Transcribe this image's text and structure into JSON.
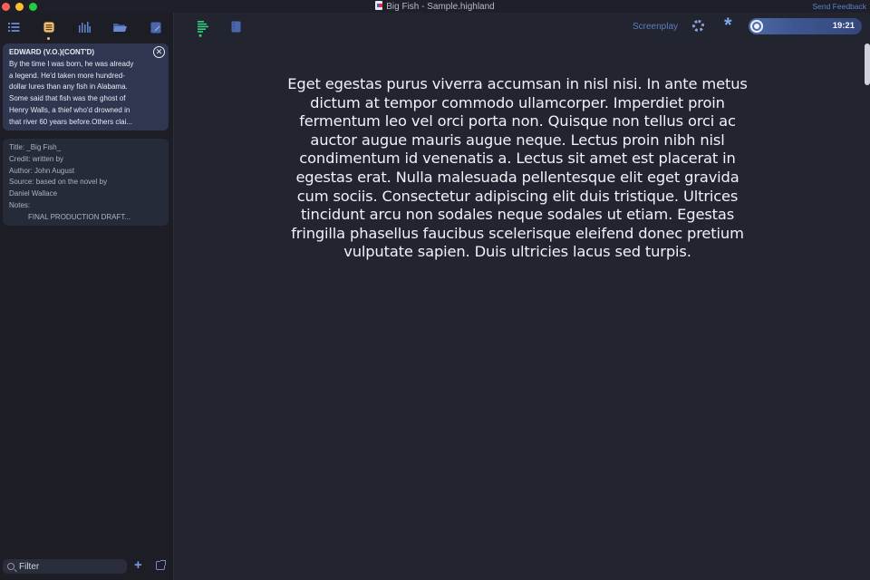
{
  "window": {
    "title": "Big Fish - Sample.highland",
    "send_feedback": "Send Feedback"
  },
  "sidebar": {
    "tabs": [
      {
        "icon": "list-icon",
        "label": "Outline",
        "active": false
      },
      {
        "icon": "scene-cards-icon",
        "label": "Navigator",
        "active": true
      },
      {
        "icon": "stats-icon",
        "label": "Statistics",
        "active": false
      },
      {
        "icon": "folder-icon",
        "label": "Files",
        "active": false
      },
      {
        "icon": "notebook-icon",
        "label": "Notes",
        "active": false
      }
    ],
    "cards": [
      {
        "heading": "EDWARD (V.O.)(CONT'D)",
        "lines": [
          "By the time I was born, he was already",
          "a legend. He'd taken more hundred-",
          "dollar lures than any fish in Alabama.",
          "Some said that fish was the ghost of",
          "Henry Walls, a thief who'd drowned in",
          "that river 60 years before.Others clai..."
        ],
        "close_icon": "close-circle-icon"
      },
      {
        "lines": [
          "Title: _Big Fish_",
          "Credit: written by",
          "Author: John August",
          "Source: based on the novel by",
          "Daniel Wallace",
          "Notes:"
        ],
        "centered_line": "FINAL PRODUCTION DRAFT..."
      }
    ],
    "filter": {
      "placeholder": "Filter",
      "value": ""
    },
    "add_icon": "plus-icon",
    "export_icon": "export-icon"
  },
  "toolbar": {
    "left_icons": [
      "text-align-icon",
      "notebook-icon"
    ],
    "mode_label": "Screenplay",
    "ring_icon": "progress-ring-icon",
    "asterisk_icon": "asterisk-icon",
    "timer": {
      "value": "19:21",
      "icon": "record-icon"
    }
  },
  "colors": {
    "accent": "#5a83c9",
    "active_tab": "#f4c27a",
    "green_icon": "#2fd37a",
    "background": "#22242f",
    "sidebar": "#1c1d25"
  },
  "editor": {
    "text": "Eget egestas purus viverra accumsan in nisl nisi. In ante metus dictum at tempor commodo ullamcorper. Imperdiet proin fermentum leo vel orci porta non. Quisque non tellus orci ac auctor augue mauris augue neque. Lectus proin nibh nisl condimentum id venenatis a. Lectus sit amet est placerat in egestas erat. Nulla malesuada pellentesque elit eget gravida cum sociis. Consectetur adipiscing elit duis tristique. Ultrices tincidunt arcu non sodales neque sodales ut etiam. Egestas fringilla phasellus faucibus scelerisque eleifend donec pretium vulputate sapien. Duis ultricies lacus sed turpis."
  }
}
